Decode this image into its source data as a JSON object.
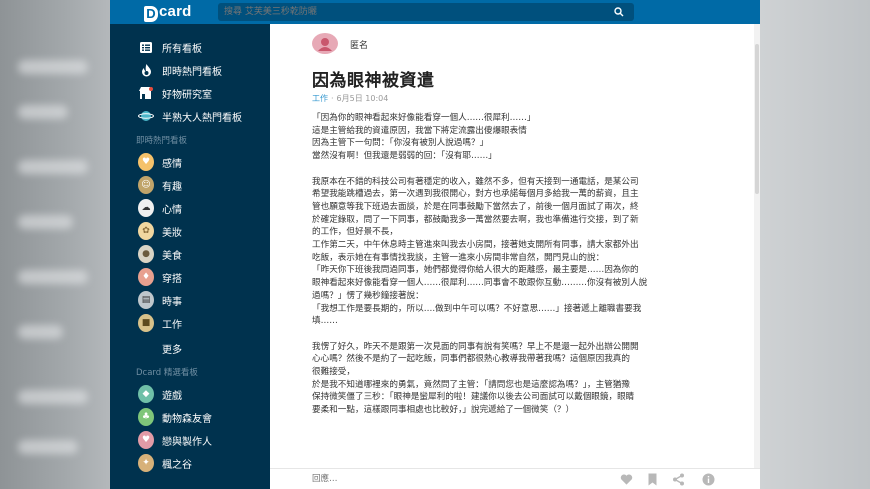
{
  "header": {
    "logo": "card",
    "search_placeholder": "搜尋 艾芙美三秒乾防曬"
  },
  "sidebar": {
    "main_items": [
      {
        "label": "所有看板",
        "icon": "list-icon"
      },
      {
        "label": "即時熱門看板",
        "icon": "fire-icon"
      },
      {
        "label": "好物研究室",
        "icon": "shop-icon"
      },
      {
        "label": "半熟大人熱門看板",
        "icon": "planet-icon"
      }
    ],
    "section_hot": "即時熱門看板",
    "hot_items": [
      {
        "label": "感情",
        "icon": "emotion-board-icon",
        "color": "#f5c26b"
      },
      {
        "label": "有趣",
        "icon": "funny-board-icon",
        "color": "#c0a46a"
      },
      {
        "label": "心情",
        "icon": "mood-board-icon",
        "color": "#f0f0f0"
      },
      {
        "label": "美妝",
        "icon": "makeup-board-icon",
        "color": "#f1d7a0"
      },
      {
        "label": "美食",
        "icon": "food-board-icon",
        "color": "#d9d4c5"
      },
      {
        "label": "穿搭",
        "icon": "dressup-board-icon",
        "color": "#e8a08f"
      },
      {
        "label": "時事",
        "icon": "news-board-icon",
        "color": "#bfc7cc"
      },
      {
        "label": "工作",
        "icon": "work-board-icon",
        "color": "#d8c28a"
      }
    ],
    "more_label": "更多",
    "section_selected": "Dcard 精選看板",
    "selected_items": [
      {
        "label": "遊戲",
        "icon": "game-board-icon",
        "color": "#6fc0a8"
      },
      {
        "label": "動物森友會",
        "icon": "animal-crossing-board-icon",
        "color": "#7fc67a"
      },
      {
        "label": "戀與製作人",
        "icon": "love-producer-board-icon",
        "color": "#e29ba7"
      },
      {
        "label": "楓之谷",
        "icon": "maplestory-board-icon",
        "color": "#d7b179"
      }
    ]
  },
  "post": {
    "author": "匿名",
    "title": "因為眼神被資遣",
    "board": "工作",
    "date": "6月5日 10:04",
    "paragraphs": [
      [
        "「因為你的眼神看起來好像能看穿一個人……很犀利……」",
        "這是主管給我的資遣原因，我當下將定流露出傻爆眼表情",
        "因為主管下一句問：「你沒有被別人說過嗎？」",
        "當然沒有啊！但我還是弱弱的回：「沒有耶……」"
      ],
      [
        "我原本在不錯的科技公司有著穩定的收入，雖然不多，但有天接到一通電話，是某公司",
        "希望我能跳槽過去，第一次遇到我很開心，對方也承諾每個月多給我一萬的薪資，且主",
        "管也願意等我下班過去面談，於是在同事鼓勵下當然去了，前後一個月面試了兩次，終",
        "於確定錄取，問了一下同事，都鼓勵我多一萬當然要去啊，我也準備進行交接，到了新",
        "的工作，但好景不長，",
        "工作第二天，中午休息時主管進來叫我去小房間，接著她支開所有同事，請大家都外出",
        "吃飯，表示她在有事情找我談，主管一進來小房間非常自然，開門見山的說：",
        "「昨天你下班後我問過同事，她們都覺得你給人很大的距離感，最主要是……因為你的",
        "眼神看起來好像能看穿一個人……很犀利……同事會不敢跟你互動………你沒有被別人說",
        "過嗎？」愣了幾秒鐘接著說：",
        "「我想工作是要長期的，所以….做到中午可以嗎？不好意思……」接著遞上離職書要我",
        "填……"
      ],
      [
        "我愣了好久，昨天不是跟第一次見面的同事有說有笑嗎？早上不是還一起外出辦公開開",
        "心心嗎？然後不是約了一起吃飯，同事們都很熱心教導我帶著我嗎？這個原因我真的",
        "很難接受，",
        "於是我不知道哪裡來的勇氣，竟然問了主管：「請問您也是這麼認為嗎？」，主管猶豫",
        "保持微笑僵了三秒：「眼神是蠻犀利的啦！建議你以後去公司面試可以戴個眼鏡，眼睛",
        "要柔和一點，這樣跟同事相處也比較好，」說完遞給了一個微笑（？）"
      ]
    ]
  },
  "reply": {
    "placeholder": "回應…"
  },
  "colors": {
    "header": "#006aa6",
    "sidebar": "#00324e",
    "link": "#3397cf"
  }
}
